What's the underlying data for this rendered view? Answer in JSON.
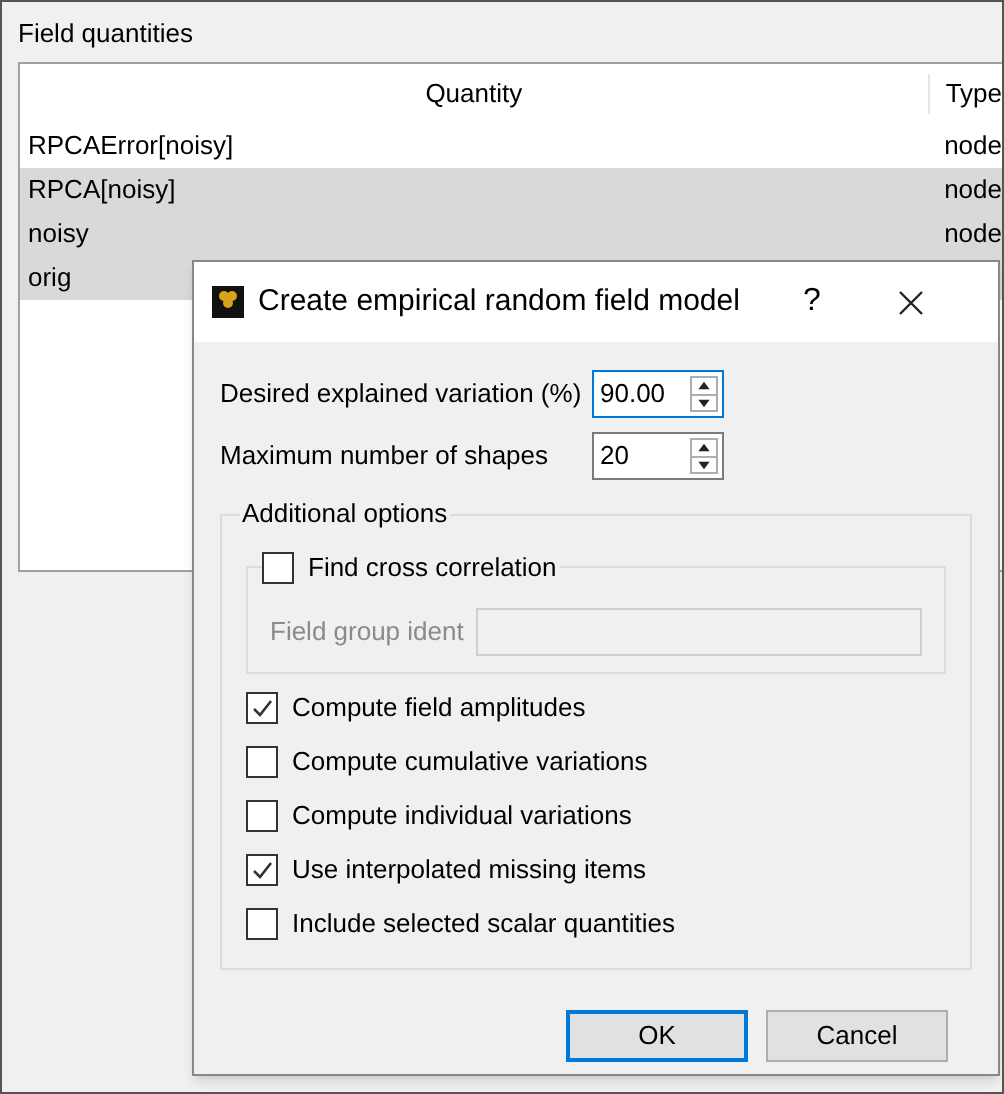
{
  "panel": {
    "title": "Field quantities"
  },
  "table": {
    "columns": [
      "Quantity",
      "Type"
    ],
    "rows": [
      {
        "quantity": "RPCAError[noisy]",
        "type": "node",
        "selected": false
      },
      {
        "quantity": "RPCA[noisy]",
        "type": "node",
        "selected": true
      },
      {
        "quantity": "noisy",
        "type": "node",
        "selected": true
      },
      {
        "quantity": "orig",
        "selected": true
      }
    ]
  },
  "dialog": {
    "title": "Create empirical random field model",
    "help": "?",
    "fields": [
      {
        "label": "Desired explained variation (%)",
        "value": "90.00",
        "focused": true
      },
      {
        "label": "Maximum number of shapes",
        "value": "20",
        "focused": false
      }
    ],
    "group": {
      "title": "Additional options",
      "cross": {
        "label": "Find cross correlation",
        "checked": false,
        "field_label": "Field group ident"
      },
      "options": [
        {
          "label": "Compute field amplitudes",
          "checked": true
        },
        {
          "label": "Compute cumulative variations",
          "checked": false
        },
        {
          "label": "Compute individual variations",
          "checked": false
        },
        {
          "label": "Use interpolated missing items",
          "checked": true
        },
        {
          "label": "Include selected scalar quantities",
          "checked": false
        }
      ]
    },
    "buttons": [
      {
        "label": "OK",
        "default": true
      },
      {
        "label": "Cancel",
        "default": false
      }
    ]
  }
}
